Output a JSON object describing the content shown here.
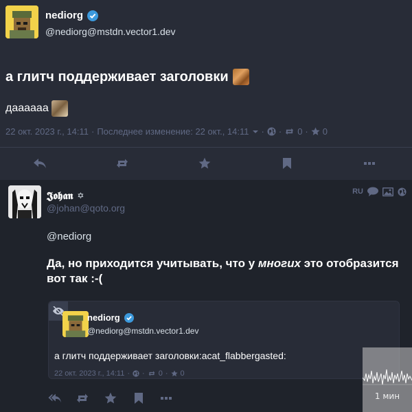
{
  "main_post": {
    "display_name": "nediorg",
    "handle": "@nediorg@mstdn.vector1.dev",
    "title": "а глитч поддерживает заголовки",
    "body": "дааааaa",
    "timestamp": "22 окт. 2023 г., 14:11",
    "separator": "·",
    "edited_label": "Последнее изменение: 22 окт., 14:11",
    "boost_count": "0",
    "fav_count": "0"
  },
  "reply_post": {
    "display_name": "𝕵𝖔𝖍𝖆𝖓",
    "name_suffix": "✡",
    "handle": "@johan@qoto.org",
    "language": "RU",
    "mention": "@nediorg",
    "text_before": "Да, но приходится учитывать, что у ",
    "text_em": "многих",
    "text_after": " это отобразится вот так :-("
  },
  "quoted_post": {
    "display_name": "nediorg",
    "handle": "@nediorg@mstdn.vector1.dev",
    "text": "а глитч поддерживает заголовки:acat_flabbergasted:",
    "timestamp": "22 окт. 2023 г., 14:11",
    "separator": "·",
    "boost_count": "0",
    "fav_count": "0"
  },
  "overlay": {
    "graph_label": "1 мин"
  },
  "colors": {
    "background": "#282c37",
    "reply_background": "#1f232b",
    "muted": "#606984",
    "verified": "#3c99dc"
  }
}
